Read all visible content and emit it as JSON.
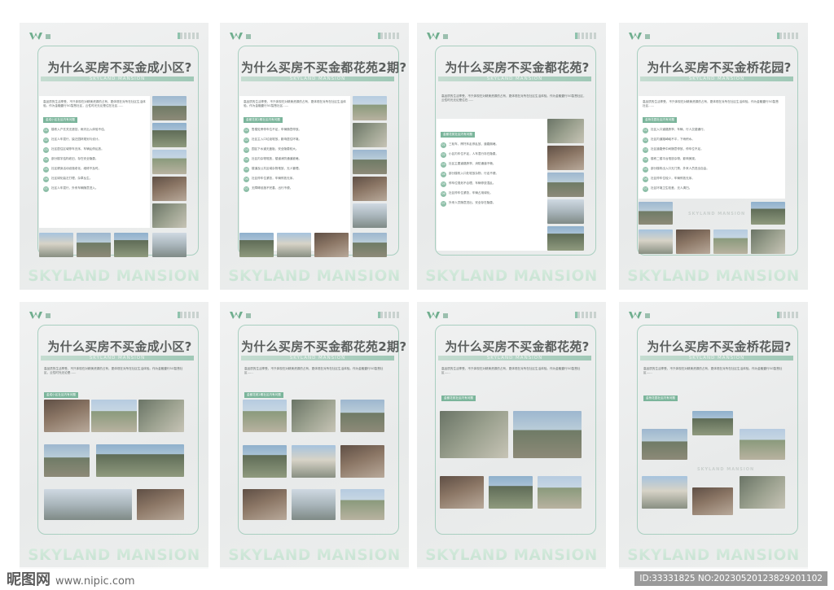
{
  "posters": [
    {
      "title": "为什么买房不买金成小区?",
      "subtitle": "SKYLAND MANSION",
      "brand": "SKYLAND MANSION",
      "tag": "金成小区社区内有问题",
      "count": 8
    },
    {
      "title": "为什么买房不买金都花苑2期?",
      "subtitle": "SKYLAND MANSION",
      "brand": "SKYLAND MANSION",
      "tag": "金都花苑2期社区内有问题",
      "count": 7
    },
    {
      "title": "为什么买房不买金都花苑?",
      "subtitle": "SKYLAND MANSION",
      "brand": "SKYLAND MANSION",
      "tag": "金都花苑社区内有问题",
      "count": 8
    },
    {
      "title": "为什么买房不买金桥花园?",
      "subtitle": "SKYLAND MANSION",
      "brand": "SKYLAND MANSION",
      "tag": "金桥花园社区内有问题",
      "count": 7
    },
    {
      "title": "为什么买房不买金成小区?",
      "subtitle": "SKYLAND MANSION",
      "brand": "SKYLAND MANSION",
      "tag": "金成小区社区内有问题"
    },
    {
      "title": "为什么买房不买金都花苑2期?",
      "subtitle": "SKYLAND MANSION",
      "brand": "SKYLAND MANSION",
      "tag": "金都花苑2期社区内有问题"
    },
    {
      "title": "为什么买房不买金都花苑?",
      "subtitle": "SKYLAND MANSION",
      "brand": "SKYLAND MANSION",
      "tag": "金都花苑社区内有问题"
    },
    {
      "title": "为什么买房不买金桥花园?",
      "subtitle": "SKYLAND MANSION",
      "brand": "SKYLAND MANSION",
      "tag": "金桥花园社区内有问题"
    }
  ],
  "watermark": {
    "site": "昵图网",
    "url": "www.nipic.com",
    "id": "ID:33331825 NO:20230520123829201102"
  }
}
